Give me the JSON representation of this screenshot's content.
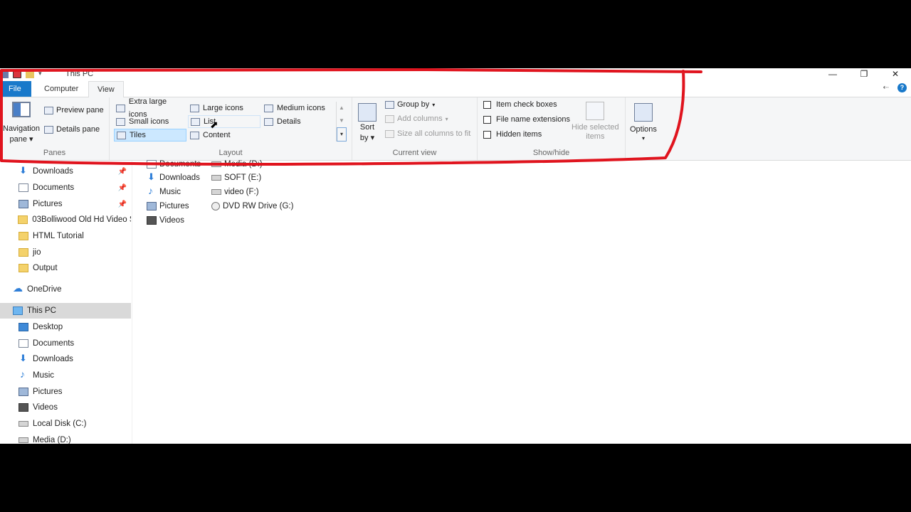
{
  "window": {
    "title": "This PC",
    "controls": {
      "minimize": "—",
      "maximize": "❐",
      "close": "✕"
    }
  },
  "tabs": {
    "file": "File",
    "computer": "Computer",
    "view": "View"
  },
  "ribbon": {
    "panes": {
      "caption": "Panes",
      "navigation_pane": "Navigation",
      "navigation_pane_2": "pane",
      "preview_pane": "Preview pane",
      "details_pane": "Details pane"
    },
    "layout": {
      "caption": "Layout",
      "extra_large_icons": "Extra large icons",
      "large_icons": "Large icons",
      "medium_icons": "Medium icons",
      "small_icons": "Small icons",
      "list": "List",
      "details": "Details",
      "tiles": "Tiles",
      "content": "Content"
    },
    "current_view": {
      "caption": "Current view",
      "sort_by": "Sort",
      "sort_by_2": "by",
      "group_by": "Group by",
      "add_columns": "Add columns",
      "size_all_columns": "Size all columns to fit"
    },
    "show_hide": {
      "caption": "Show/hide",
      "item_check_boxes": "Item check boxes",
      "file_name_extensions": "File name extensions",
      "hidden_items": "Hidden items",
      "hide_selected": "Hide selected",
      "hide_selected_2": "items"
    },
    "options": {
      "label": "Options"
    }
  },
  "nav": {
    "quick_access": [
      {
        "label": "Downloads",
        "icon": "downloads-icon",
        "pinned": true
      },
      {
        "label": "Documents",
        "icon": "documents-icon",
        "pinned": true
      },
      {
        "label": "Pictures",
        "icon": "pictures-icon",
        "pinned": true
      },
      {
        "label": "03Bolliwood Old Hd Video S",
        "icon": "folder-icon"
      },
      {
        "label": "HTML Tutorial",
        "icon": "folder-icon"
      },
      {
        "label": "jio",
        "icon": "folder-icon"
      },
      {
        "label": "Output",
        "icon": "folder-icon"
      }
    ],
    "onedrive": "OneDrive",
    "this_pc": "This PC",
    "this_pc_items": [
      {
        "label": "Desktop",
        "icon": "desktop-icon"
      },
      {
        "label": "Documents",
        "icon": "documents-icon"
      },
      {
        "label": "Downloads",
        "icon": "downloads-icon"
      },
      {
        "label": "Music",
        "icon": "music-icon"
      },
      {
        "label": "Pictures",
        "icon": "pictures-icon"
      },
      {
        "label": "Videos",
        "icon": "videos-icon"
      },
      {
        "label": "Local Disk (C:)",
        "icon": "drive-icon"
      },
      {
        "label": "Media (D:)",
        "icon": "drive-icon"
      }
    ]
  },
  "content": {
    "folders": [
      "Documents",
      "Downloads",
      "Music",
      "Pictures",
      "Videos"
    ],
    "drives": [
      "Media (D:)",
      "SOFT (E:)",
      "video (F:)",
      "DVD RW Drive (G:)"
    ]
  },
  "colors": {
    "accent": "#1979ca",
    "annotation": "#e0141e",
    "selection": "#cce8ff"
  }
}
